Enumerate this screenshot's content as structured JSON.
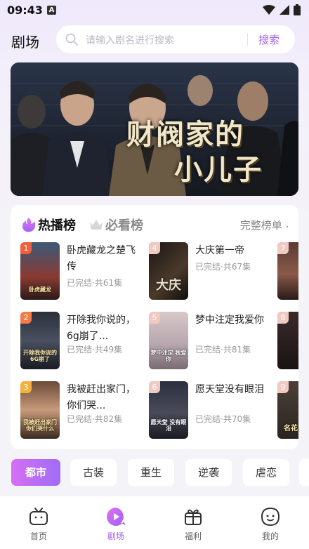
{
  "status": {
    "time": "09:43",
    "notif": "A"
  },
  "header": {
    "title": "剧场",
    "search_placeholder": "请输入剧名进行搜索",
    "search_button": "搜索"
  },
  "banner": {
    "title_line1": "财阀家的",
    "title_line2": "小儿子"
  },
  "ranking": {
    "tab_hot": "热播榜",
    "tab_must": "必看榜",
    "full_list": "完整榜单",
    "items": [
      {
        "rank": "1",
        "title": "卧虎藏龙之楚飞传",
        "meta": "已完结·共61集",
        "cover_text": "卧虎藏龙"
      },
      {
        "rank": "2",
        "title": "开除我你说的，6g崩了...",
        "meta": "已完结·共49集",
        "cover_text": "开除我你说的 6G崩了"
      },
      {
        "rank": "3",
        "title": "我被赶出家门，你们哭...",
        "meta": "已完结·共82集",
        "cover_text": "我被赶出家门 你们哭什么"
      },
      {
        "rank": "4",
        "title": "大庆第一帝",
        "meta": "已完结·共67集",
        "cover_text": "大庆"
      },
      {
        "rank": "5",
        "title": "梦中注定我爱你",
        "meta": "已完结·共81集",
        "cover_text": "梦中注定 我爱你"
      },
      {
        "rank": "6",
        "title": "愿天堂没有眼泪",
        "meta": "已完结·共70集",
        "cover_text": "愿天堂 没有眼泪"
      },
      {
        "rank": "7"
      },
      {
        "rank": "8"
      },
      {
        "rank": "9",
        "cover_text": "名花"
      }
    ]
  },
  "genres": [
    "都市",
    "古装",
    "重生",
    "逆袭",
    "虐恋"
  ],
  "tabbar": [
    {
      "label": "首页",
      "icon": "tv-icon"
    },
    {
      "label": "剧场",
      "icon": "play-icon"
    },
    {
      "label": "福利",
      "icon": "gift-icon"
    },
    {
      "label": "我的",
      "icon": "profile-icon"
    }
  ],
  "colors": {
    "accent": "#a35ef0",
    "chip_gradient_start": "#d56ff3",
    "chip_gradient_end": "#9f6df7",
    "rank1": "#f0603a",
    "rank2": "#f57c44",
    "rank3": "#f5b23b",
    "rank_other": "#f2c9c0"
  }
}
